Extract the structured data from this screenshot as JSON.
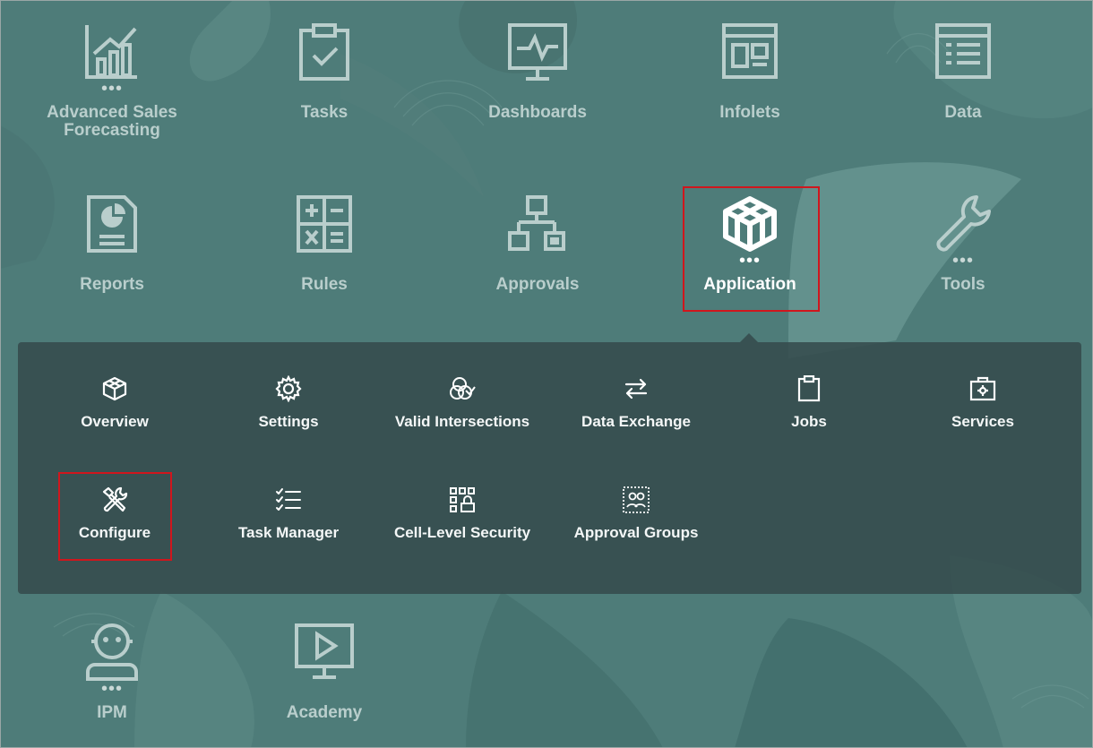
{
  "tiles": [
    {
      "label": "Advanced Sales Forecasting",
      "line1": "Advanced Sales",
      "line2": "Forecasting",
      "icon": "sales-forecast-chart-icon",
      "has_more": true
    },
    {
      "label": "Tasks",
      "icon": "clipboard-check-icon",
      "has_more": false
    },
    {
      "label": "Dashboards",
      "icon": "monitor-pulse-icon",
      "has_more": false
    },
    {
      "label": "Infolets",
      "icon": "infolet-layout-icon",
      "has_more": false
    },
    {
      "label": "Data",
      "icon": "data-grid-icon",
      "has_more": false
    },
    {
      "label": "Reports",
      "icon": "report-pie-icon",
      "has_more": false
    },
    {
      "label": "Rules",
      "icon": "calculator-icon",
      "has_more": false
    },
    {
      "label": "Approvals",
      "icon": "hierarchy-icon",
      "has_more": false
    },
    {
      "label": "Application",
      "icon": "cube-icon",
      "has_more": true,
      "selected": true
    },
    {
      "label": "Tools",
      "icon": "wrench-icon",
      "has_more": true
    },
    {
      "label": "IPM",
      "icon": "robot-icon",
      "has_more": true
    },
    {
      "label": "Academy",
      "icon": "play-screen-icon",
      "has_more": false
    }
  ],
  "more_glyph": "•••",
  "submenu": [
    {
      "label": "Overview",
      "icon": "cube-outline-icon"
    },
    {
      "label": "Settings",
      "icon": "gear-icon"
    },
    {
      "label": "Valid Intersections",
      "icon": "venn-check-icon"
    },
    {
      "label": "Data Exchange",
      "icon": "swap-arrows-icon"
    },
    {
      "label": "Jobs",
      "icon": "clipboard-icon"
    },
    {
      "label": "Services",
      "icon": "service-kit-icon"
    },
    {
      "label": "Configure",
      "icon": "tools-icon",
      "highlighted": true
    },
    {
      "label": "Task Manager",
      "icon": "checklist-icon"
    },
    {
      "label": "Cell-Level Security",
      "icon": "grid-lock-icon"
    },
    {
      "label": "Approval Groups",
      "icon": "group-icon"
    }
  ],
  "colors": {
    "accent_highlight": "#d0161d",
    "background": "#4e7c79",
    "tile_text": "#b9cecc"
  }
}
